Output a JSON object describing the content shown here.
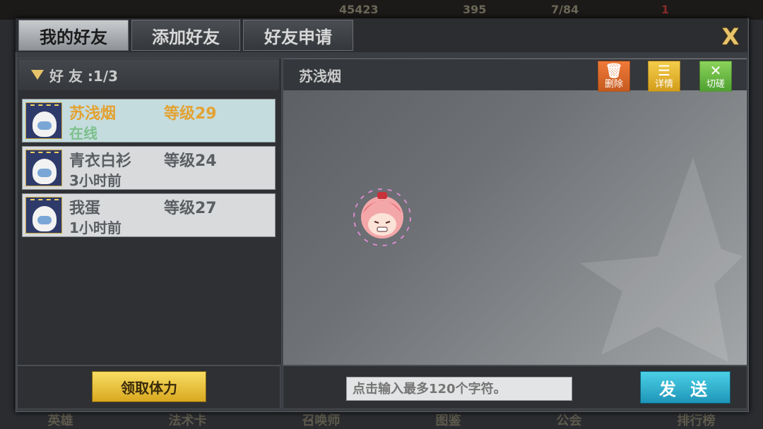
{
  "hud": {
    "gold": "45423",
    "gems": "395",
    "stamina": "7/84",
    "notification_count": "1"
  },
  "tabs": [
    {
      "label": "我的好友",
      "active": true
    },
    {
      "label": "添加好友",
      "active": false
    },
    {
      "label": "好友申请",
      "active": false
    }
  ],
  "close_label": "X",
  "friends_panel": {
    "header": "好 友 :1/3"
  },
  "friends": [
    {
      "name": "苏浅烟",
      "level": "等级29",
      "status": "在线",
      "selected": true
    },
    {
      "name": "青衣白衫",
      "level": "等级24",
      "status": "3小时前",
      "selected": false
    },
    {
      "name": "我蛋",
      "level": "等级27",
      "status": "1小时前",
      "selected": false
    }
  ],
  "chat": {
    "title": "苏浅烟",
    "actions": {
      "delete": "删除",
      "details": "详情",
      "switch": "切磋"
    },
    "input_placeholder": "点击输入最多120个字符。",
    "send_label": "发 送"
  },
  "claim_stamina_label": "领取体力",
  "bottom_nav": [
    "英雄",
    "法术卡",
    "召唤师",
    "图鉴",
    "公会",
    "排行榜"
  ],
  "colors": {
    "selected_name": "#e3a233",
    "online_status": "#7cc08a",
    "accent_gold": "#e7c46a",
    "send_button": "#1e95b8"
  }
}
